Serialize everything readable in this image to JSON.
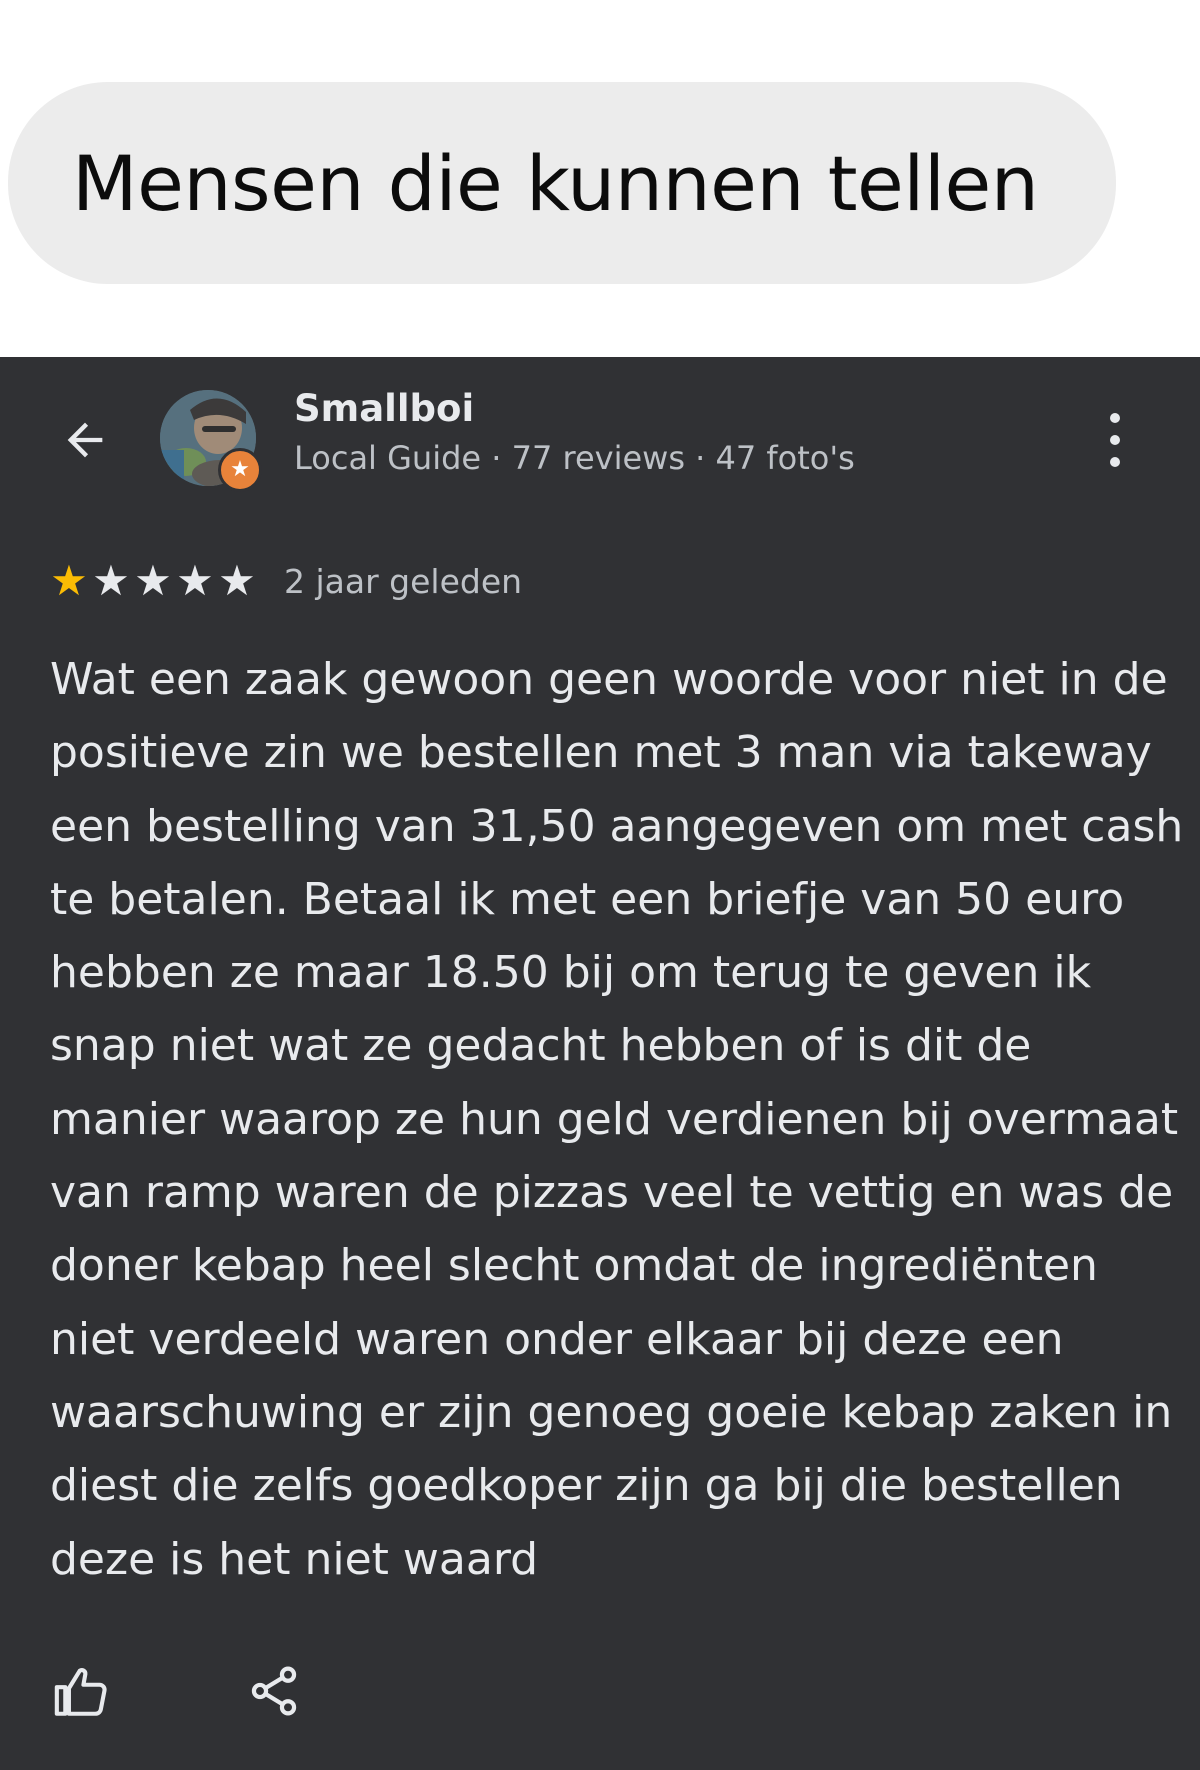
{
  "caption": {
    "text": "Mensen die kunnen tellen"
  },
  "review": {
    "author": {
      "name": "Smallboi",
      "meta": "Local Guide · 77 reviews · 47 foto's"
    },
    "rating": {
      "value": 1,
      "max": 5
    },
    "date": "2 jaar geleden",
    "text_lines": [
      "Wat een zaak gewoon geen woorde voor niet in de",
      "positieve zin we bestellen met 3 man via takeway",
      "een bestelling van 31,50 aangegeven om met cash",
      "te betalen. Betaal ik met een briefje van 50 euro",
      "hebben ze maar 18.50 bij om terug te geven ik",
      "snap niet wat ze gedacht hebben of is dit de",
      "manier waarop ze hun geld verdienen bij overmaat",
      "van ramp waren de pizzas veel te vettig en was de",
      "doner kebap heel slecht omdat de ingrediënten",
      "niet verdeeld waren onder elkaar bij deze een",
      "waarschuwing er zijn genoeg goeie kebap zaken in",
      "diest die zelfs goedkoper zijn ga bij die bestellen",
      "deze is het niet waard"
    ]
  },
  "icons": {
    "back": "arrow-left-icon",
    "more": "more-vert-icon",
    "badge": "local-guide-star-icon",
    "like": "thumb-up-icon",
    "share": "share-icon"
  },
  "colors": {
    "panel_bg": "#303134",
    "bubble_bg": "#ececec",
    "star_filled": "#fbbc04",
    "star_empty": "#e8eaed",
    "text_primary": "#e8eaed",
    "text_secondary": "#bdc1c6",
    "badge": "#e8833a"
  }
}
